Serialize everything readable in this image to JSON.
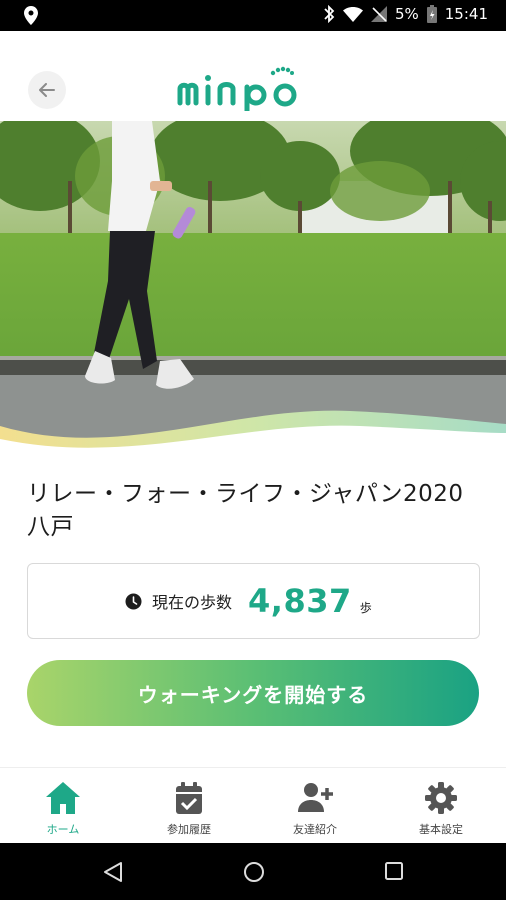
{
  "status_bar": {
    "battery": "5%",
    "time": "15:41"
  },
  "header": {
    "logo_text": "minpo"
  },
  "event": {
    "title": "リレー・フォー・ライフ・ジャパン2020八戸"
  },
  "steps": {
    "label": "現在の歩数",
    "value": "4,837",
    "unit": "歩"
  },
  "start_button": {
    "label": "ウォーキングを開始する"
  },
  "bottom_nav": {
    "items": [
      {
        "label": "ホーム",
        "icon": "home-icon",
        "active": true
      },
      {
        "label": "参加履歴",
        "icon": "calendar-check-icon",
        "active": false
      },
      {
        "label": "友達紹介",
        "icon": "add-user-icon",
        "active": false
      },
      {
        "label": "基本設定",
        "icon": "gear-icon",
        "active": false
      }
    ]
  },
  "colors": {
    "accent": "#1ea888",
    "gradient_start": "#a9d46a",
    "gradient_end": "#1aa283"
  }
}
